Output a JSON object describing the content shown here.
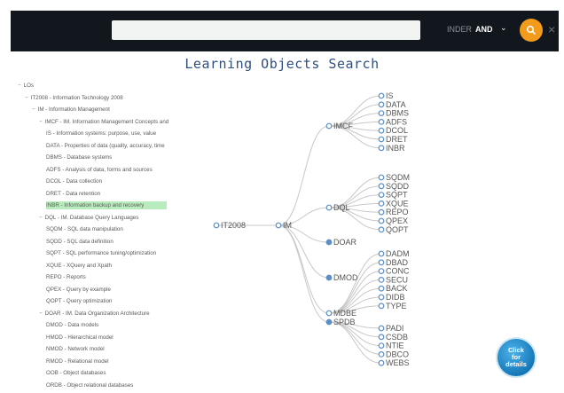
{
  "header": {
    "search_placeholder": "",
    "operator_label": "INDER",
    "operator_value": "AND",
    "chevron_icon": "chevron-down-icon",
    "go_icon": "search-icon",
    "close_icon": "close-icon",
    "close_glyph": "×",
    "accent_color": "#f39b1a",
    "bar_color": "#12171d"
  },
  "page_title": "Learning Objects Search",
  "tree": [
    {
      "label": "LOs",
      "toggle": "−",
      "depth": 0
    },
    {
      "label": "IT2008 - Information Technology 2008",
      "toggle": "−",
      "depth": 1
    },
    {
      "label": "IM - Information Management",
      "toggle": "−",
      "depth": 2
    },
    {
      "label": "IMCF - IM. Information Management Concepts and",
      "toggle": "−",
      "depth": 3
    },
    {
      "label": "IS - Information systems: purpose, use, value",
      "toggle": "",
      "depth": 4
    },
    {
      "label": "DATA - Properties of data (quality, accuracy, time",
      "toggle": "",
      "depth": 4
    },
    {
      "label": "DBMS - Database systems",
      "toggle": "",
      "depth": 4
    },
    {
      "label": "ADFS - Analysis of data, forms and sources",
      "toggle": "",
      "depth": 4
    },
    {
      "label": "DCOL - Data collection",
      "toggle": "",
      "depth": 4
    },
    {
      "label": "DRET - Data retention",
      "toggle": "",
      "depth": 4
    },
    {
      "label": "INBR - Information backup and recovery",
      "toggle": "",
      "depth": 4,
      "selected": true
    },
    {
      "label": "DQL - IM. Database Query Languages",
      "toggle": "−",
      "depth": 3
    },
    {
      "label": "SQDM - SQL data manipulation",
      "toggle": "",
      "depth": 4
    },
    {
      "label": "SQDD - SQL data definition",
      "toggle": "",
      "depth": 4
    },
    {
      "label": "SQPT - SQL performance tuning/optimization",
      "toggle": "",
      "depth": 4
    },
    {
      "label": "XQUE - XQuery and Xpath",
      "toggle": "",
      "depth": 4
    },
    {
      "label": "REPO - Reports",
      "toggle": "",
      "depth": 4
    },
    {
      "label": "QPEX - Query by example",
      "toggle": "",
      "depth": 4
    },
    {
      "label": "QOPT - Query optimization",
      "toggle": "",
      "depth": 4
    },
    {
      "label": "DOAR - IM. Data Organization Architecture",
      "toggle": "−",
      "depth": 3
    },
    {
      "label": "DMOD - Data models",
      "toggle": "",
      "depth": 4
    },
    {
      "label": "HMOD - Hierarchical model",
      "toggle": "",
      "depth": 4
    },
    {
      "label": "NMOD - Network model",
      "toggle": "",
      "depth": 4
    },
    {
      "label": "RMOD - Relational model",
      "toggle": "",
      "depth": 4
    },
    {
      "label": "OOB - Object databases",
      "toggle": "",
      "depth": 4
    },
    {
      "label": "ORDB - Object relational databases",
      "toggle": "",
      "depth": 4
    }
  ],
  "graph": {
    "root": "IT2008",
    "level1": "IM",
    "groups": [
      {
        "name": "IMCF",
        "filled": false,
        "children": [
          "IS",
          "DATA",
          "DBMS",
          "ADFS",
          "DCOL",
          "DRET",
          "INBR"
        ]
      },
      {
        "name": "DQL",
        "filled": false,
        "children": [
          "SQDM",
          "SQDD",
          "SQPT",
          "XQUE",
          "REPO",
          "QPEX",
          "QOPT"
        ]
      },
      {
        "name": "DOAR",
        "filled": true,
        "children": []
      },
      {
        "name": "DMOD",
        "filled": true,
        "children": []
      },
      {
        "name": "MDBE",
        "filled": false,
        "children": [
          "DADM",
          "DBAD",
          "CONC",
          "SECU",
          "BACK",
          "DIDB",
          "TYPE"
        ]
      },
      {
        "name": "SPDB",
        "filled": true,
        "children": [
          "PADI",
          "CSDB",
          "NTIE",
          "DBCO",
          "WEBS"
        ]
      }
    ],
    "node_color": "#5b8fc7",
    "link_color": "#c8c8c8"
  },
  "details_button": {
    "line1": "Click",
    "line2": "for",
    "line3": "details",
    "icon": "hand-pointer-icon"
  }
}
